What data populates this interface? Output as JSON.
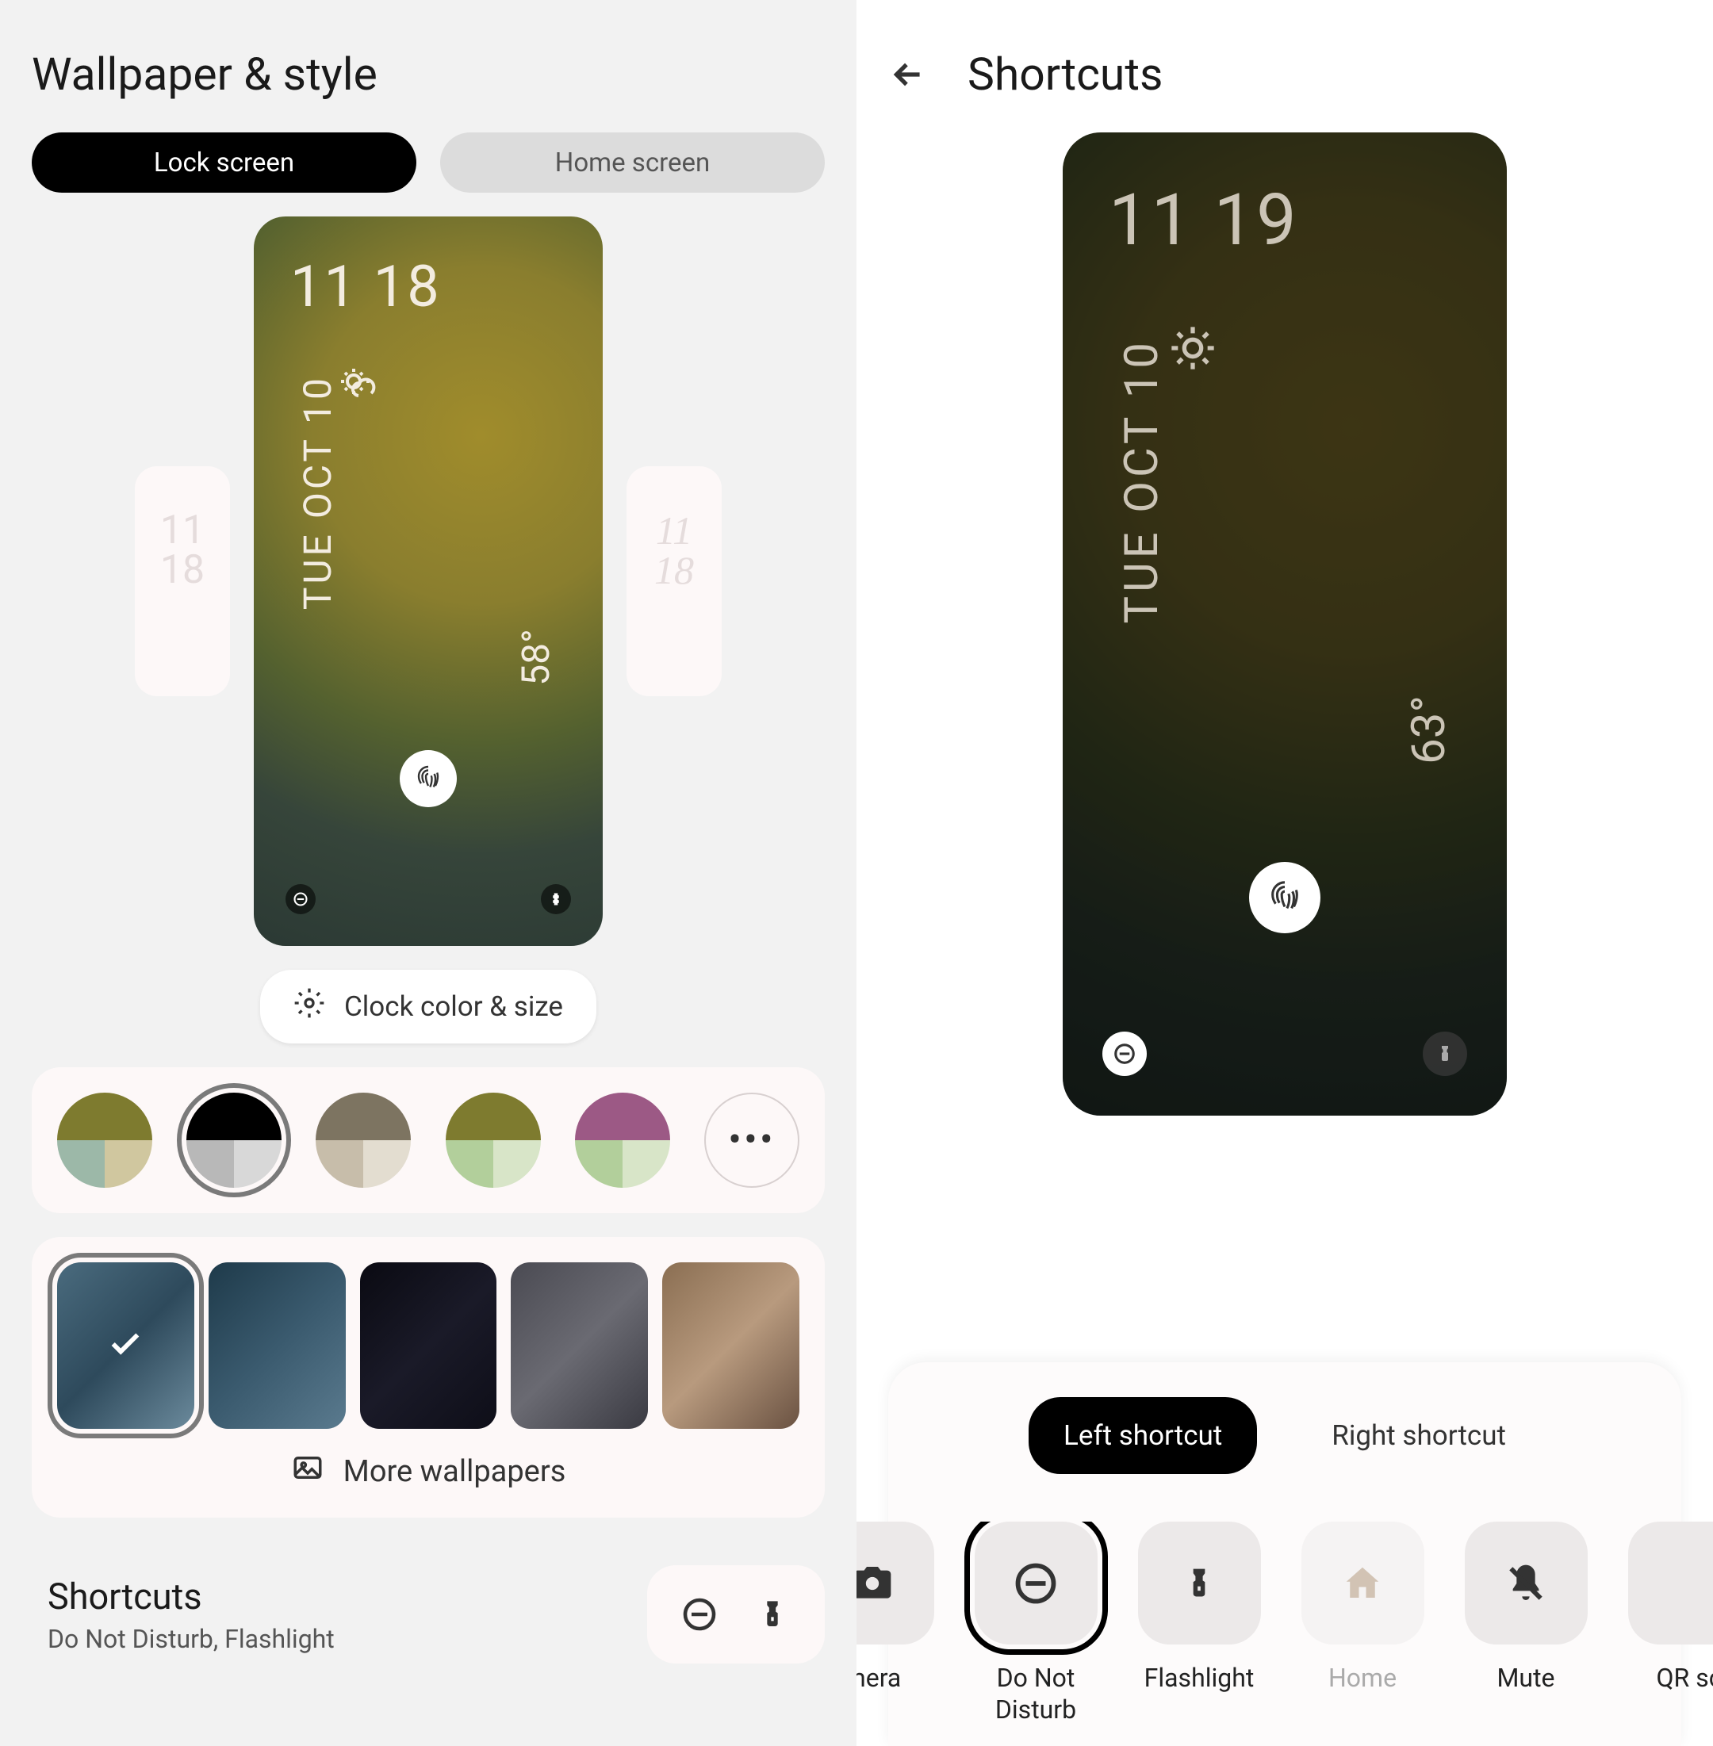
{
  "left": {
    "title": "Wallpaper & style",
    "tabs": {
      "lock": "Lock screen",
      "home": "Home screen"
    },
    "preview": {
      "time": "11 18",
      "date": "TUE OCT 10",
      "temp": "58°",
      "side_left_time_a": "11",
      "side_left_time_b": "18",
      "side_right_time_a": "11",
      "side_right_time_b": "18"
    },
    "clock_button": "Clock color & size",
    "more_wallpapers": "More wallpapers",
    "shortcuts": {
      "title": "Shortcuts",
      "subtitle": "Do Not Disturb, Flashlight"
    }
  },
  "right": {
    "title": "Shortcuts",
    "preview": {
      "time": "11 19",
      "date": "TUE OCT 10",
      "temp": "63°"
    },
    "tabs": {
      "left": "Left shortcut",
      "right": "Right shortcut"
    },
    "options": {
      "camera": "mera",
      "dnd": "Do Not Disturb",
      "flashlight": "Flashlight",
      "home": "Home",
      "mute": "Mute",
      "qr": "QR sc"
    }
  }
}
